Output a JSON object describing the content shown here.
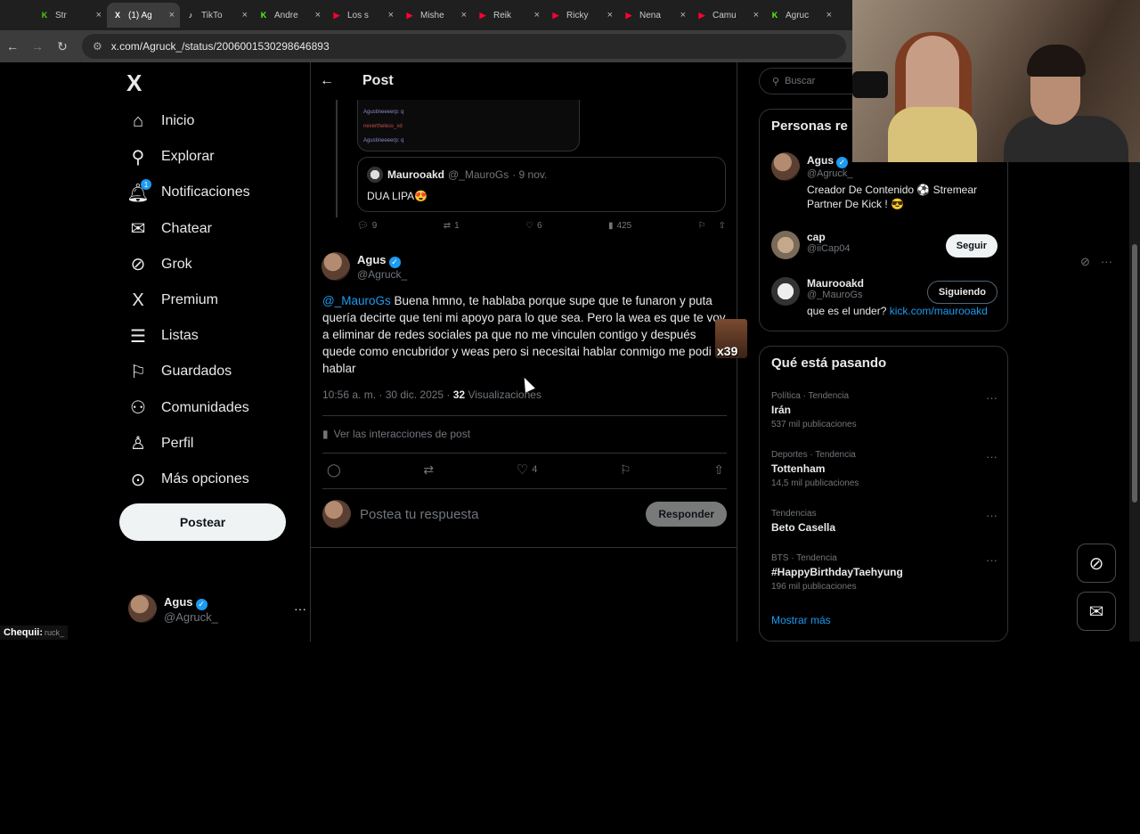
{
  "browser": {
    "tabs": [
      {
        "label": "Str",
        "color": "#4fd10a",
        "glyph": "K"
      },
      {
        "label": "(1) Ag",
        "color": "#ffffff",
        "glyph": "X",
        "active": true
      },
      {
        "label": "TikTo",
        "color": "#ffffff",
        "glyph": "♪"
      },
      {
        "label": "Andre",
        "color": "#53fc18",
        "glyph": "K"
      },
      {
        "label": "Los s",
        "color": "#ff0033",
        "glyph": "▶"
      },
      {
        "label": "Mishe",
        "color": "#ff0033",
        "glyph": "▶"
      },
      {
        "label": "Reik",
        "color": "#ff0033",
        "glyph": "▶"
      },
      {
        "label": "Ricky",
        "color": "#ff0033",
        "glyph": "▶"
      },
      {
        "label": "Nena",
        "color": "#ff0033",
        "glyph": "▶"
      },
      {
        "label": "Camu",
        "color": "#ff0033",
        "glyph": "▶"
      },
      {
        "label": "Agruc",
        "color": "#53fc18",
        "glyph": "K"
      }
    ],
    "url": "x.com/Agruck_/status/2006001530298646893"
  },
  "sidebar": {
    "logo": "X",
    "items": [
      {
        "label": "Inicio",
        "icon": "home-icon"
      },
      {
        "label": "Explorar",
        "icon": "search-icon"
      },
      {
        "label": "Notificaciones",
        "icon": "bell-icon",
        "badge": "1"
      },
      {
        "label": "Chatear",
        "icon": "mail-icon"
      },
      {
        "label": "Grok",
        "icon": "grok-icon"
      },
      {
        "label": "Premium",
        "icon": "x-icon"
      },
      {
        "label": "Listas",
        "icon": "list-icon"
      },
      {
        "label": "Guardados",
        "icon": "bookmark-icon"
      },
      {
        "label": "Comunidades",
        "icon": "people-icon"
      },
      {
        "label": "Perfil",
        "icon": "person-icon"
      },
      {
        "label": "Más opciones",
        "icon": "more-circle-icon"
      }
    ],
    "post_button": "Postear",
    "account": {
      "name": "Agus",
      "handle": "@Agruck_"
    }
  },
  "main": {
    "header_title": "Post",
    "embedded_lines": [
      "Agustineeeerp: q",
      "nevertheless_xd",
      "Agustineeeerp: q"
    ],
    "quote": {
      "name": "Maurooakd",
      "handle": "@_MauroGs",
      "date": "· 9 nov.",
      "text": "DUA LIPA😍"
    },
    "prev_actions": {
      "replies": "9",
      "reposts": "1",
      "likes": "6",
      "views": "425"
    },
    "post": {
      "name": "Agus",
      "handle": "@Agruck_",
      "mention": "@_MauroGs",
      "text": " Buena hmno, te hablaba porque supe que te funaron y puta quería decirte que teni mi apoyo para lo que sea. Pero la wea es que te voy a eliminar de redes sociales pa que no me vinculen contigo y después quede como encubridor y weas pero si necesitai hablar conmigo me podi hablar",
      "time": "10:56 a. m. · 30 dic. 2025 · ",
      "views_count": "32",
      "views_label": " Visualizaciones",
      "interactions": "Ver las interacciones de post",
      "likes": "4"
    },
    "sticker_text": "x39",
    "reply_placeholder": "Postea tu respuesta",
    "reply_button": "Responder"
  },
  "right": {
    "search_placeholder": "Buscar",
    "people_title": "Personas re",
    "people": [
      {
        "name": "Agus",
        "handle": "@Agruck_",
        "bio": "Creador De Contenido ⚽ Stremear Partner De Kick ! 😎"
      },
      {
        "name": "cap",
        "handle": "@iiCap04",
        "button": "Seguir"
      },
      {
        "name": "Maurooakd",
        "handle": "@_MauroGs",
        "button": "Siguiendo",
        "bio_prefix": "que es el under? ",
        "bio_link": "kick.com/maurooakd"
      }
    ],
    "trends_title": "Qué está pasando",
    "trends": [
      {
        "category": "Política · Tendencia",
        "title": "Irán",
        "count": "537 mil publicaciones"
      },
      {
        "category": "Deportes · Tendencia",
        "title": "Tottenham",
        "count": "14,5 mil publicaciones"
      },
      {
        "category": "Tendencias",
        "title": "Beto Casella",
        "count": ""
      },
      {
        "category": "BTS · Tendencia",
        "title": "#HappyBirthdayTaehyung",
        "count": "196 mil publicaciones"
      }
    ],
    "show_more": "Mostrar más"
  },
  "overlay": {
    "chat_name": "Chequii:",
    "chat_rest": "ruck_"
  }
}
